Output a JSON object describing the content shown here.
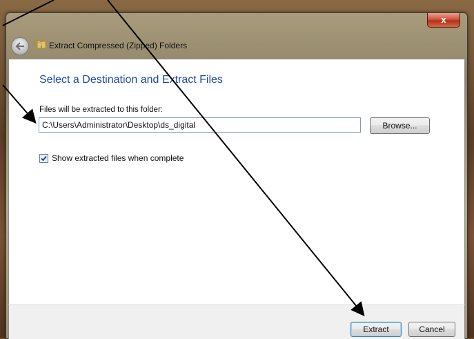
{
  "window": {
    "title": "Extract Compressed (Zipped) Folders",
    "close_label": "x"
  },
  "main": {
    "heading": "Select a Destination and Extract Files",
    "path_label": "Files will be extracted to this folder:",
    "path_value": "C:\\Users\\Administrator\\Desktop\\ds_digital",
    "browse_label": "Browse...",
    "show_files_label": "Show extracted files when complete",
    "show_files_checked": true
  },
  "footer": {
    "extract_label": "Extract",
    "cancel_label": "Cancel"
  },
  "icons": {
    "back": "back-arrow-icon",
    "folder": "zip-folder-icon",
    "close": "close-icon",
    "check": "checkmark-icon"
  },
  "colors": {
    "heading": "#1b4aa6",
    "close_button": "#c9432a"
  }
}
